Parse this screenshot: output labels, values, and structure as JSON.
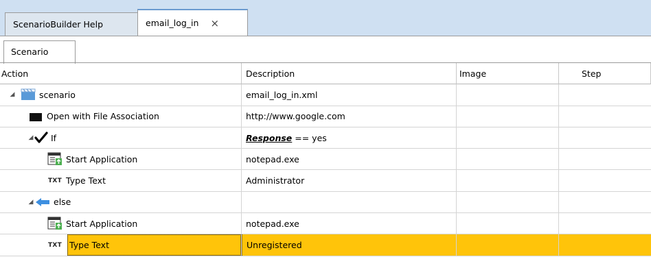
{
  "tabs": [
    {
      "label": "ScenarioBuilder Help"
    },
    {
      "label": "email_log_in",
      "close": "×"
    }
  ],
  "subtab": {
    "label": "Scenario"
  },
  "columns": {
    "action": "Action",
    "description": "Description",
    "image": "Image",
    "step": "Step"
  },
  "rows": [
    {
      "action": "scenario",
      "description": "email_log_in.xml",
      "icon": "clapperboard-icon",
      "expander": "◢"
    },
    {
      "action": "Open with File Association",
      "description": "http://www.google.com",
      "icon": "folder-icon"
    },
    {
      "action": "If",
      "description_keyword": "Response",
      "description_rest": " == yes",
      "icon": "checkmark-icon",
      "expander": "◢"
    },
    {
      "action": "Start Application",
      "description": "notepad.exe",
      "icon": "start-application-icon"
    },
    {
      "action": "Type Text",
      "description": "Administrator",
      "icon": "type-text-icon",
      "icon_text": "TXT"
    },
    {
      "action": "else",
      "description": "",
      "icon": "left-arrow-icon",
      "expander": "◢"
    },
    {
      "action": "Start Application",
      "description": "notepad.exe",
      "icon": "start-application-icon"
    },
    {
      "action": "Type Text",
      "description": "Unregistered",
      "icon": "type-text-icon",
      "icon_text": "TXT",
      "selected": true
    }
  ],
  "colors": {
    "selection": "#ffc40a",
    "tabstrip": "#cfe0f2"
  }
}
